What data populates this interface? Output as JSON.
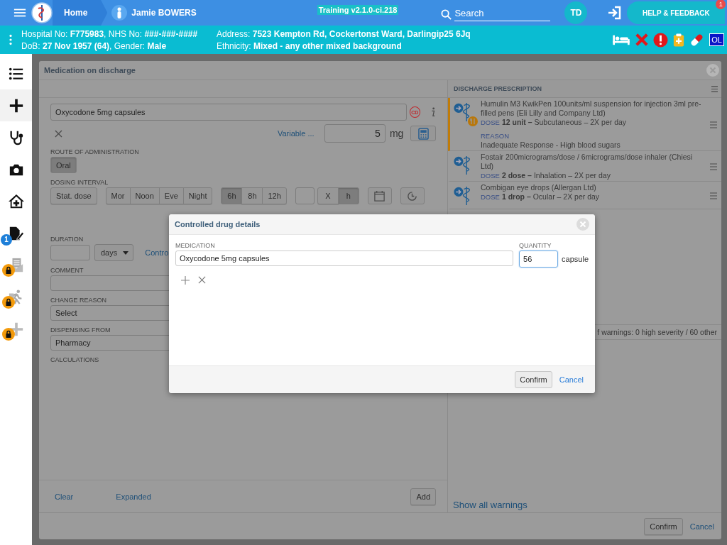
{
  "top_bar": {
    "home": "Home",
    "patient_name": "Jamie BOWERS",
    "build": "Training v2.1.0-ci.218",
    "search": {
      "placeholder": "Search"
    },
    "user_initials": "TD",
    "help_button": "HELP & FEEDBACK",
    "help_badge": "1"
  },
  "patient_banner": {
    "left": [
      "Hospital No: **F775983**, NHS No: **###-###-####**",
      "DoB: **27 Nov 1957 (64)**, Gender: **Male**"
    ],
    "right": [
      "Address: **7523 Kempton Rd, Cockertonst Ward, Darlingip25 6Jq**",
      "Ethnicity: **Mixed - any other mixed background**"
    ],
    "alerts": [
      {
        "kind": "bed"
      },
      {
        "kind": "cross"
      },
      {
        "kind": "warning"
      },
      {
        "kind": "clipboard"
      },
      {
        "kind": "pill"
      },
      {
        "kind": "text",
        "text": "OL"
      }
    ]
  },
  "sidebar": {
    "items": [
      {
        "kind": "list",
        "selected": false,
        "locked": false
      },
      {
        "kind": "plus",
        "selected": true,
        "locked": false
      },
      {
        "kind": "stethoscope",
        "selected": false,
        "locked": false
      },
      {
        "kind": "camera",
        "selected": false,
        "locked": false
      },
      {
        "kind": "home",
        "selected": false,
        "locked": false
      },
      {
        "kind": "edit",
        "selected": false,
        "locked": false,
        "badge": "1"
      },
      {
        "kind": "mail",
        "selected": false,
        "locked": true
      },
      {
        "kind": "walker",
        "selected": false,
        "locked": true
      },
      {
        "kind": "plus",
        "selected": false,
        "locked": true
      }
    ]
  },
  "dialog": {
    "title": "Medication on discharge",
    "form": {
      "drug": {
        "value": "Oxycodone 5mg capsules",
        "cd_badge": "CD"
      },
      "variable_link": "Variable ...",
      "dose": {
        "value": "5",
        "unit": "mg"
      },
      "route": {
        "label": "ROUTE OF ADMINISTRATION",
        "options": [
          {
            "label": "Oral",
            "selected": true
          }
        ]
      },
      "interval": {
        "label": "DOSING INTERVAL",
        "groups": [
          [
            {
              "kind": "button",
              "label": "Stat. dose",
              "selected": false
            }
          ],
          [
            {
              "kind": "button",
              "label": "Mor",
              "selected": false
            },
            {
              "kind": "button",
              "label": "Noon",
              "selected": false
            },
            {
              "kind": "button",
              "label": "Eve",
              "selected": false
            },
            {
              "kind": "button",
              "label": "Night",
              "selected": false
            }
          ],
          [
            {
              "kind": "button",
              "label": "6h",
              "selected": true
            },
            {
              "kind": "button",
              "label": "8h",
              "selected": false
            },
            {
              "kind": "button",
              "label": "12h",
              "selected": false
            }
          ],
          [
            {
              "kind": "field"
            }
          ],
          [
            {
              "kind": "button",
              "label": "X",
              "selected": false
            },
            {
              "kind": "button",
              "label": "h",
              "selected": true
            }
          ],
          [
            {
              "kind": "calendar"
            }
          ],
          [
            {
              "kind": "clock"
            }
          ]
        ]
      },
      "duration": {
        "label": "DURATION",
        "unit": "days",
        "link": "Contro"
      },
      "comment": {
        "label": "COMMENT"
      },
      "change_reason": {
        "label": "CHANGE REASON",
        "value": "Select"
      },
      "dispensing": {
        "label": "DISPENSING FROM",
        "value": "Pharmacy"
      },
      "calculations_label": "CALCULATIONS",
      "footer_links": [
        "Clear",
        "Expanded"
      ],
      "add_button": "Add"
    },
    "prescription": {
      "title": "DISCHARGE PRESCRIPTION",
      "items": [
        {
          "name": "Humulin M3 KwikPen 100units/ml suspension for injection 3ml pre-filled pens (Eli Lilly and Company Ltd)",
          "dose_label": "DOSE",
          "dose": "**12 unit –** Subcutaneous – 2X per day",
          "flagged": true,
          "reason_label": "REASON",
          "reason": "Inadequate Response - High blood sugars"
        },
        {
          "name": "Fostair 200micrograms/dose / 6micrograms/dose inhaler (Chiesi Ltd)",
          "dose_label": "DOSE",
          "dose": "**2 dose –** Inhalation – 2X per day",
          "flagged": false
        },
        {
          "name": "Combigan eye drops (Allergan Ltd)",
          "dose_label": "DOSE",
          "dose": "**1 drop –** Ocular – 2X per day",
          "flagged": false
        }
      ],
      "warnings": "f warnings: 0 high severity / 60 other",
      "show_all": "Show all warnings"
    },
    "buttons": [
      "Confirm",
      "Cancel"
    ]
  },
  "modal": {
    "title": "Controlled drug details",
    "medication_label": "MEDICATION",
    "medication": "Oxycodone 5mg capsules",
    "quantity_label": "QUANTITY",
    "quantity": {
      "value": "56",
      "focused": true
    },
    "unit": "capsule",
    "buttons": [
      "Confirm",
      "Cancel"
    ]
  }
}
